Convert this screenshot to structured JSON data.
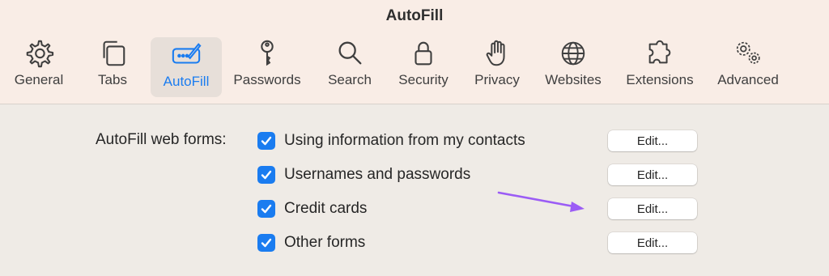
{
  "window": {
    "title": "AutoFill"
  },
  "toolbar": {
    "items": [
      {
        "label": "General",
        "icon": "gear-icon"
      },
      {
        "label": "Tabs",
        "icon": "tabs-icon"
      },
      {
        "label": "AutoFill",
        "icon": "autofill-icon",
        "active": true
      },
      {
        "label": "Passwords",
        "icon": "key-icon"
      },
      {
        "label": "Search",
        "icon": "search-icon"
      },
      {
        "label": "Security",
        "icon": "lock-icon"
      },
      {
        "label": "Privacy",
        "icon": "hand-icon"
      },
      {
        "label": "Websites",
        "icon": "globe-icon"
      },
      {
        "label": "Extensions",
        "icon": "puzzle-icon"
      },
      {
        "label": "Advanced",
        "icon": "gears-icon"
      }
    ]
  },
  "autofill": {
    "section_label": "AutoFill web forms:",
    "options": [
      {
        "label": "Using information from my contacts",
        "checked": true,
        "button": "Edit..."
      },
      {
        "label": "Usernames and passwords",
        "checked": true,
        "button": "Edit..."
      },
      {
        "label": "Credit cards",
        "checked": true,
        "button": "Edit..."
      },
      {
        "label": "Other forms",
        "checked": true,
        "button": "Edit..."
      }
    ]
  },
  "colors": {
    "accent": "#1a7cf0",
    "annotation_arrow": "#9b5cf5",
    "toolbar_bg": "#f9ede6",
    "content_bg": "#efebe6"
  }
}
